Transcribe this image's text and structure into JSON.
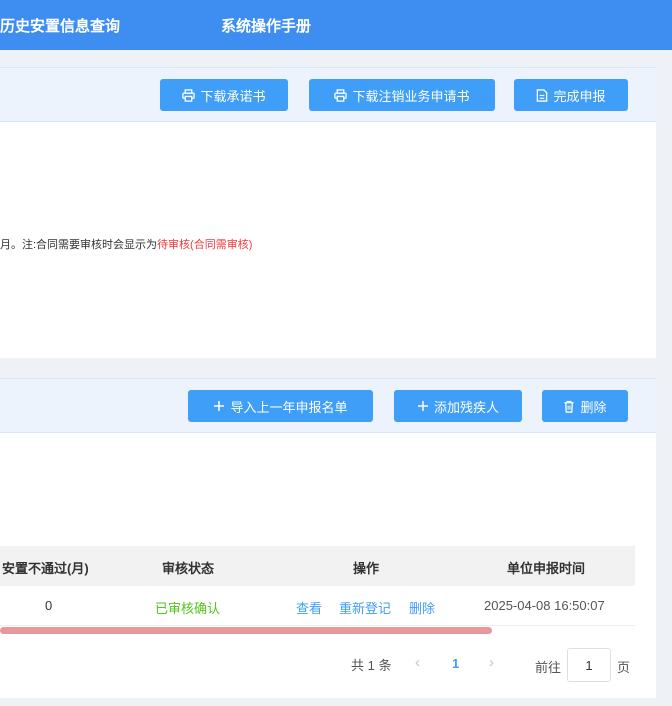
{
  "nav": {
    "item1": "历史安置信息查询",
    "item2": "系统操作手册"
  },
  "declaration": {
    "buttons": {
      "download_commitment": "下载承诺书",
      "download_cancel_application": "下载注销业务申请书",
      "complete_declaration": "完成申报"
    },
    "note_prefix": "月。注:合同需要审核时会显示为",
    "note_highlight": "待审核(合同需审核)"
  },
  "disabled_list": {
    "buttons": {
      "import_last_year": "导入上一年申报名单",
      "add_disabled_person": "添加残疾人",
      "delete": "删除"
    },
    "table": {
      "headers": [
        "安置不通过(月)",
        "审核状态",
        "操作",
        "单位申报时间"
      ],
      "rows": [
        {
          "months_failed": "0",
          "status": "已审核确认",
          "action_view": "查看",
          "action_reregister": "重新登记",
          "action_delete": "删除",
          "declare_time": "2025-04-08 16:50:07"
        }
      ]
    },
    "pagination": {
      "total": "共 1 条",
      "current_page": "1",
      "goto_label": "前往",
      "goto_value": "1",
      "page_suffix": "页"
    }
  },
  "colors": {
    "primary": "#3f9ef8",
    "nav_bg": "#3d8ef0",
    "status_ok": "#52c41a",
    "note_red": "#f03b3b"
  }
}
